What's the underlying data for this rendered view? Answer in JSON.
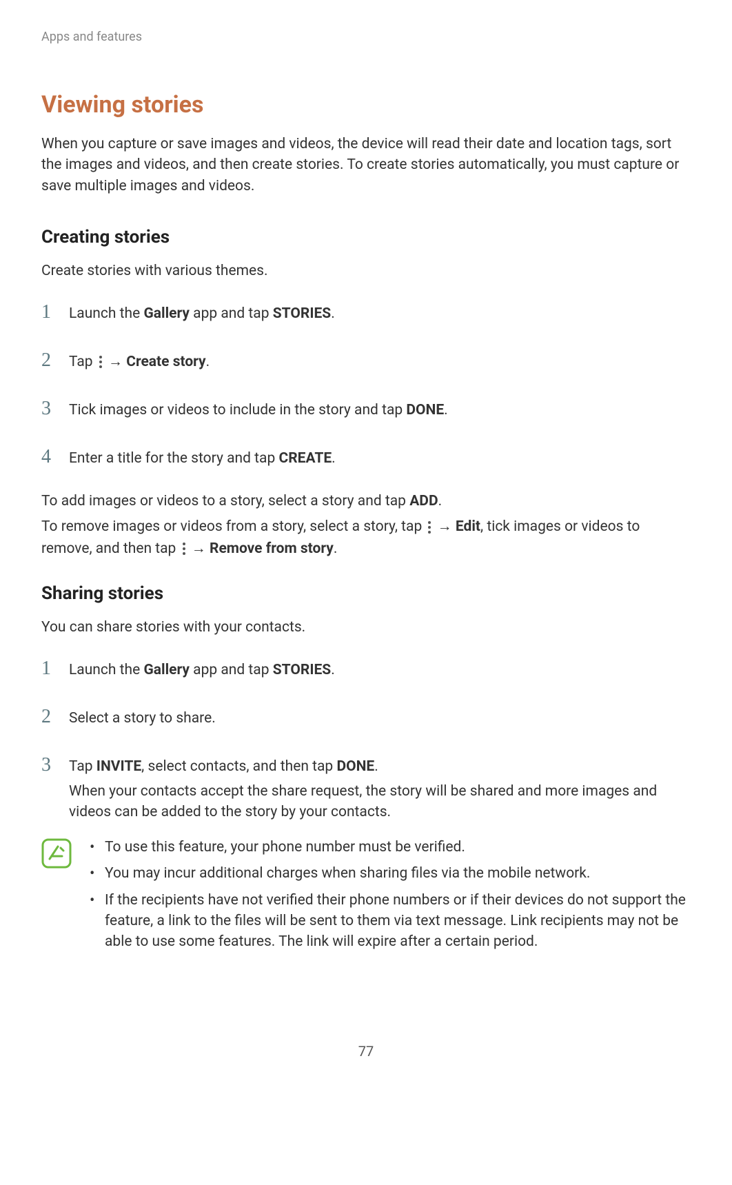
{
  "header": "Apps and features",
  "mainTitle": "Viewing stories",
  "intro": "When you capture or save images and videos, the device will read their date and location tags, sort the images and videos, and then create stories. To create stories automatically, you must capture or save multiple images and videos.",
  "creating": {
    "title": "Creating stories",
    "intro": "Create stories with various themes.",
    "steps": {
      "s1_pre": "Launch the ",
      "s1_bold1": "Gallery",
      "s1_mid": " app and tap ",
      "s1_bold2": "STORIES",
      "s1_end": ".",
      "s2_pre": "Tap ",
      "s2_arrow": " → ",
      "s2_bold": "Create story",
      "s2_end": ".",
      "s3_pre": "Tick images or videos to include in the story and tap ",
      "s3_bold": "DONE",
      "s3_end": ".",
      "s4_pre": "Enter a title for the story and tap ",
      "s4_bold": "CREATE",
      "s4_end": "."
    },
    "after1_pre": "To add images or videos to a story, select a story and tap ",
    "after1_bold": "ADD",
    "after1_end": ".",
    "after2_pre": "To remove images or videos from a story, select a story, tap ",
    "after2_arrow": " → ",
    "after2_bold1": "Edit",
    "after2_mid": ", tick images or videos to remove, and then tap ",
    "after2_arrow2": " → ",
    "after2_bold2": "Remove from story",
    "after2_end": "."
  },
  "sharing": {
    "title": "Sharing stories",
    "intro": "You can share stories with your contacts.",
    "steps": {
      "s1_pre": "Launch the ",
      "s1_bold1": "Gallery",
      "s1_mid": " app and tap ",
      "s1_bold2": "STORIES",
      "s1_end": ".",
      "s2": "Select a story to share.",
      "s3_pre": "Tap ",
      "s3_bold1": "INVITE",
      "s3_mid": ", select contacts, and then tap ",
      "s3_bold2": "DONE",
      "s3_end": ".",
      "s3_sub": "When your contacts accept the share request, the story will be shared and more images and videos can be added to the story by your contacts."
    },
    "notes": {
      "n1": "To use this feature, your phone number must be verified.",
      "n2": "You may incur additional charges when sharing files via the mobile network.",
      "n3": "If the recipients have not verified their phone numbers or if their devices do not support the feature, a link to the files will be sent to them via text message. Link recipients may not be able to use some features. The link will expire after a certain period."
    }
  },
  "pageNumber": "77",
  "nums": {
    "n1": "1",
    "n2": "2",
    "n3": "3",
    "n4": "4"
  }
}
